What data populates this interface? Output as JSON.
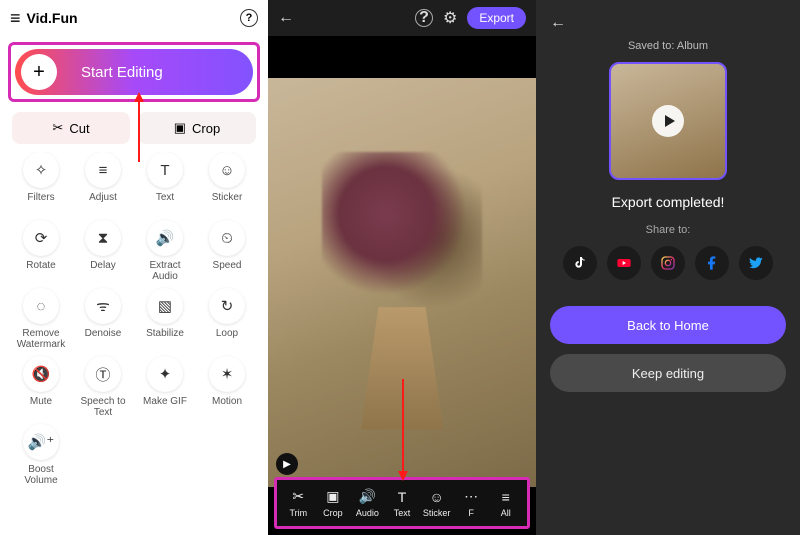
{
  "app": {
    "title": "Vid.Fun"
  },
  "start": {
    "label": "Start Editing"
  },
  "cutcrop": {
    "cut": "Cut",
    "crop": "Crop"
  },
  "tools": [
    {
      "name": "filters",
      "label": "Filters",
      "icon": "✧"
    },
    {
      "name": "adjust",
      "label": "Adjust",
      "icon": "≡"
    },
    {
      "name": "text",
      "label": "Text",
      "icon": "T"
    },
    {
      "name": "sticker",
      "label": "Sticker",
      "icon": "☺"
    },
    {
      "name": "rotate",
      "label": "Rotate",
      "icon": "⟳"
    },
    {
      "name": "delay",
      "label": "Delay",
      "icon": "⧗"
    },
    {
      "name": "extract-audio",
      "label": "Extract Audio",
      "icon": "🔊"
    },
    {
      "name": "speed",
      "label": "Speed",
      "icon": "⏲"
    },
    {
      "name": "remove-watermark",
      "label": "Remove Watermark",
      "icon": "◌"
    },
    {
      "name": "denoise",
      "label": "Denoise",
      "icon": "ᯤ"
    },
    {
      "name": "stabilize",
      "label": "Stabilize",
      "icon": "▧"
    },
    {
      "name": "loop",
      "label": "Loop",
      "icon": "↻"
    },
    {
      "name": "mute",
      "label": "Mute",
      "icon": "🔇"
    },
    {
      "name": "speech-to-text",
      "label": "Speech to Text",
      "icon": "Ⓣ"
    },
    {
      "name": "make-gif",
      "label": "Make GIF",
      "icon": "✦"
    },
    {
      "name": "motion",
      "label": "Motion",
      "icon": "✶"
    },
    {
      "name": "boost-volume",
      "label": "Boost Volume",
      "icon": "🔊⁺"
    }
  ],
  "editor": {
    "export": "Export",
    "toolbar": [
      {
        "name": "trim",
        "label": "Trim",
        "icon": "✂"
      },
      {
        "name": "crop",
        "label": "Crop",
        "icon": "▣"
      },
      {
        "name": "audio",
        "label": "Audio",
        "icon": "🔊"
      },
      {
        "name": "text",
        "label": "Text",
        "icon": "T"
      },
      {
        "name": "sticker",
        "label": "Sticker",
        "icon": "☺"
      },
      {
        "name": "filter",
        "label": "F",
        "icon": "⋯"
      },
      {
        "name": "all",
        "label": "All",
        "icon": "≡"
      }
    ]
  },
  "export": {
    "saved_to": "Saved to: Album",
    "completed": "Export completed!",
    "share_to": "Share to:",
    "back_home": "Back to Home",
    "keep_editing": "Keep editing",
    "socials": [
      {
        "name": "tiktok",
        "color": "#000"
      },
      {
        "name": "youtube",
        "color": "#ff0033"
      },
      {
        "name": "instagram",
        "color": "#e1306c"
      },
      {
        "name": "facebook",
        "color": "#1877f2"
      },
      {
        "name": "twitter",
        "color": "#1da1f2"
      }
    ]
  }
}
